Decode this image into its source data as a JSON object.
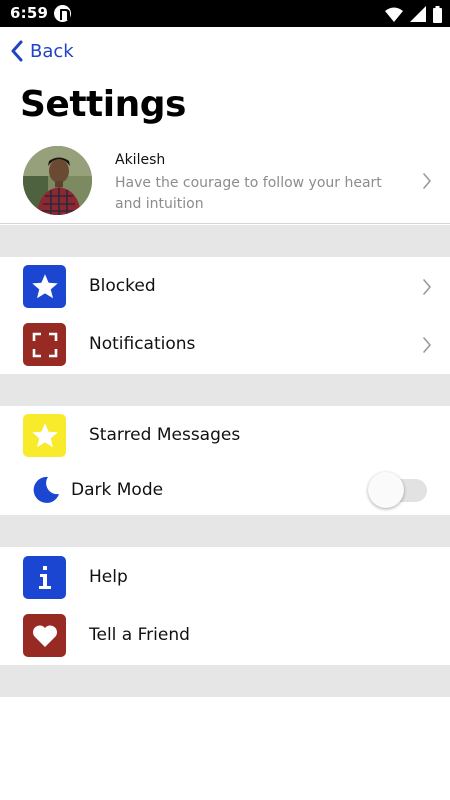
{
  "status_bar": {
    "time": "6:59",
    "icons": [
      "app-notification-icon",
      "wifi-icon",
      "signal-icon",
      "battery-icon"
    ]
  },
  "nav": {
    "back_label": "Back",
    "back_icon": "chevron-left-icon"
  },
  "page": {
    "title": "Settings"
  },
  "profile": {
    "name": "Akilesh",
    "status": "Have the courage to follow your heart and intuition",
    "chevron_icon": "chevron-right-icon"
  },
  "sections": {
    "blocked": {
      "label": "Blocked",
      "icon": "star-icon",
      "icon_bg": "#1b46d1"
    },
    "notifications": {
      "label": "Notifications",
      "icon": "focus-frame-icon",
      "icon_bg": "#972a22"
    },
    "starred": {
      "label": "Starred Messages",
      "icon": "star-icon",
      "icon_bg": "#f7eb2c"
    },
    "dark_mode": {
      "label": "Dark Mode",
      "icon": "moon-icon",
      "enabled": false
    },
    "help": {
      "label": "Help",
      "icon": "info-icon",
      "icon_bg": "#1b46d1"
    },
    "tell_friend": {
      "label": "Tell a Friend",
      "icon": "heart-icon",
      "icon_bg": "#972a22"
    }
  },
  "colors": {
    "accent": "#2143c5",
    "divider": "#e6e6e6",
    "secondary_text": "#8c8c8c"
  }
}
